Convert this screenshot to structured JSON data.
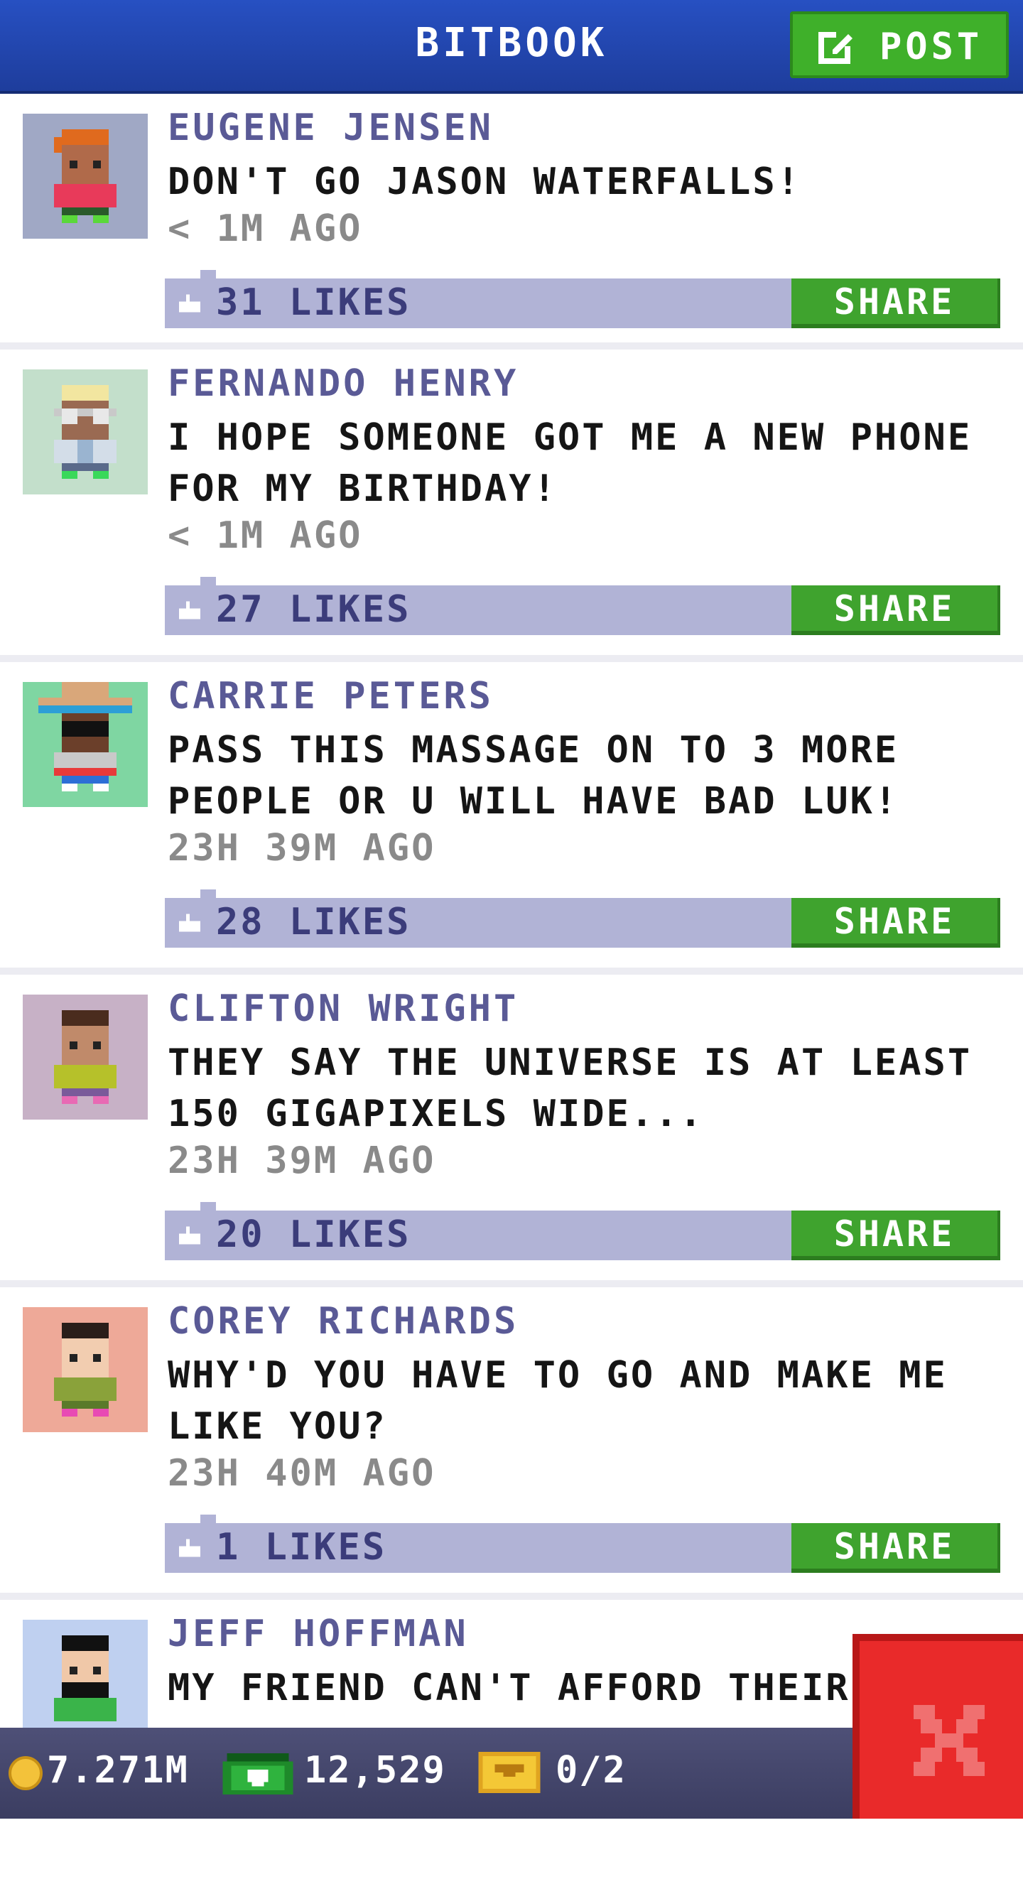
{
  "header": {
    "title": "BITBOOK",
    "post_label": "POST"
  },
  "posts": [
    {
      "name": "EUGENE JENSEN",
      "text": "DON'T GO JASON WATERFALLS!",
      "time": "< 1M AGO",
      "likes": "31 LIKES",
      "share": "SHARE"
    },
    {
      "name": "FERNANDO HENRY",
      "text": "I HOPE SOMEONE GOT ME A NEW PHONE FOR MY BIRTHDAY!",
      "time": "< 1M AGO",
      "likes": "27 LIKES",
      "share": "SHARE"
    },
    {
      "name": "CARRIE PETERS",
      "text": "PASS THIS MASSAGE ON TO 3 MORE PEOPLE OR U WILL HAVE BAD LUK!",
      "time": "23H 39M AGO",
      "likes": "28 LIKES",
      "share": "SHARE"
    },
    {
      "name": "CLIFTON WRIGHT",
      "text": "THEY SAY THE UNIVERSE IS AT LEAST 150 GIGAPIXELS WIDE...",
      "time": "23H 39M AGO",
      "likes": "20 LIKES",
      "share": "SHARE"
    },
    {
      "name": "COREY RICHARDS",
      "text": "WHY'D YOU HAVE TO GO AND MAKE ME LIKE YOU?",
      "time": "23H 40M AGO",
      "likes": "1 LIKES",
      "share": "SHARE"
    },
    {
      "name": "JEFF HOFFMAN",
      "text": "MY FRIEND CAN'T AFFORD THEIR"
    }
  ],
  "status_bar": {
    "coins": "7.271M",
    "bux": "12,529",
    "tickets": "0/2"
  },
  "icons": {
    "post": "edit-icon",
    "like": "thumbs-up-icon",
    "coin": "coin-icon",
    "bux": "bux-icon",
    "ticket": "ticket-icon",
    "close": "close-icon"
  },
  "colors": {
    "header": "#2750c2",
    "post_button": "#3fb02a",
    "share_button": "#3fa32e",
    "like_bar": "#b1b3d6",
    "name_text": "#5a5a96",
    "bottom_bar": "#4e5077",
    "close_button": "#e92a2a"
  }
}
